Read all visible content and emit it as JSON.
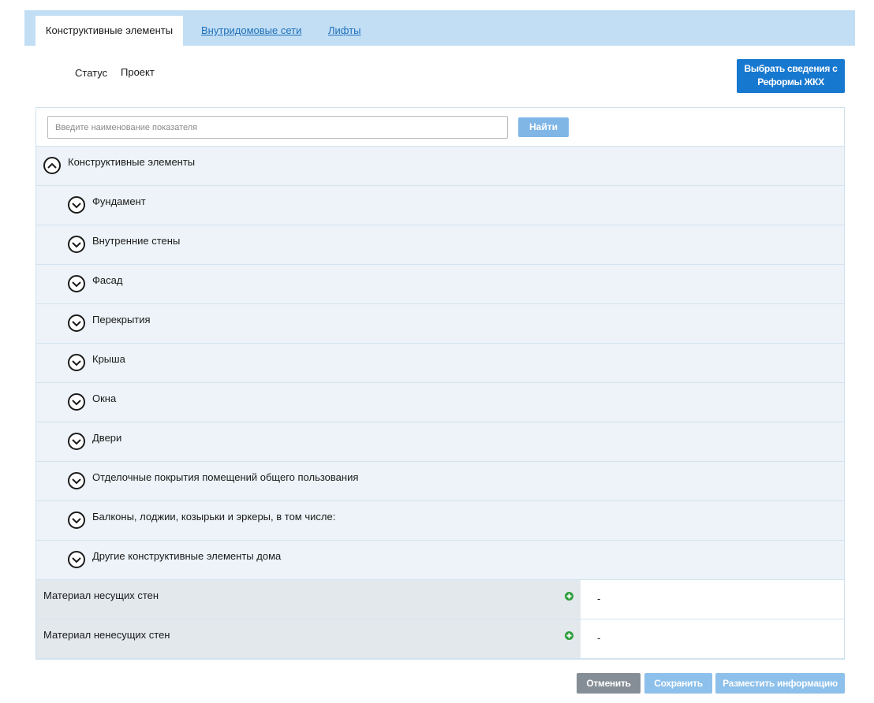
{
  "tabs": [
    {
      "label": "Конструктивные элементы",
      "active": true
    },
    {
      "label": "Внутридомовые сети",
      "active": false
    },
    {
      "label": "Лифты",
      "active": false
    }
  ],
  "status": {
    "label": "Статус",
    "value": "Проект"
  },
  "select_button": {
    "line1": "Выбрать сведения с",
    "line2": "Реформы ЖКХ"
  },
  "search": {
    "placeholder": "Введите наименование показателя",
    "value": "",
    "button_label": "Найти"
  },
  "tree": {
    "root_label": "Конструктивные элементы",
    "children": [
      "Фундамент",
      "Внутренние стены",
      "Фасад",
      "Перекрытия",
      "Крыша",
      "Окна",
      "Двери",
      "Отделочные покрытия помещений общего пользования",
      "Балконы, лоджии, козырьки и эркеры, в том числе:",
      "Другие конструктивные элементы дома"
    ]
  },
  "attributes": [
    {
      "name": "Материал несущих стен",
      "value": "-"
    },
    {
      "name": "Материал ненесущих стен",
      "value": "-"
    }
  ],
  "footer": {
    "cancel_label": "Отменить",
    "save_label": "Сохранить",
    "publish_label": "Разместить информацию"
  },
  "colors": {
    "tab_bar": "#c2def5",
    "primary_button": "#1778d0",
    "link": "#1c6fb8",
    "add_icon": "#2e9e3b"
  }
}
